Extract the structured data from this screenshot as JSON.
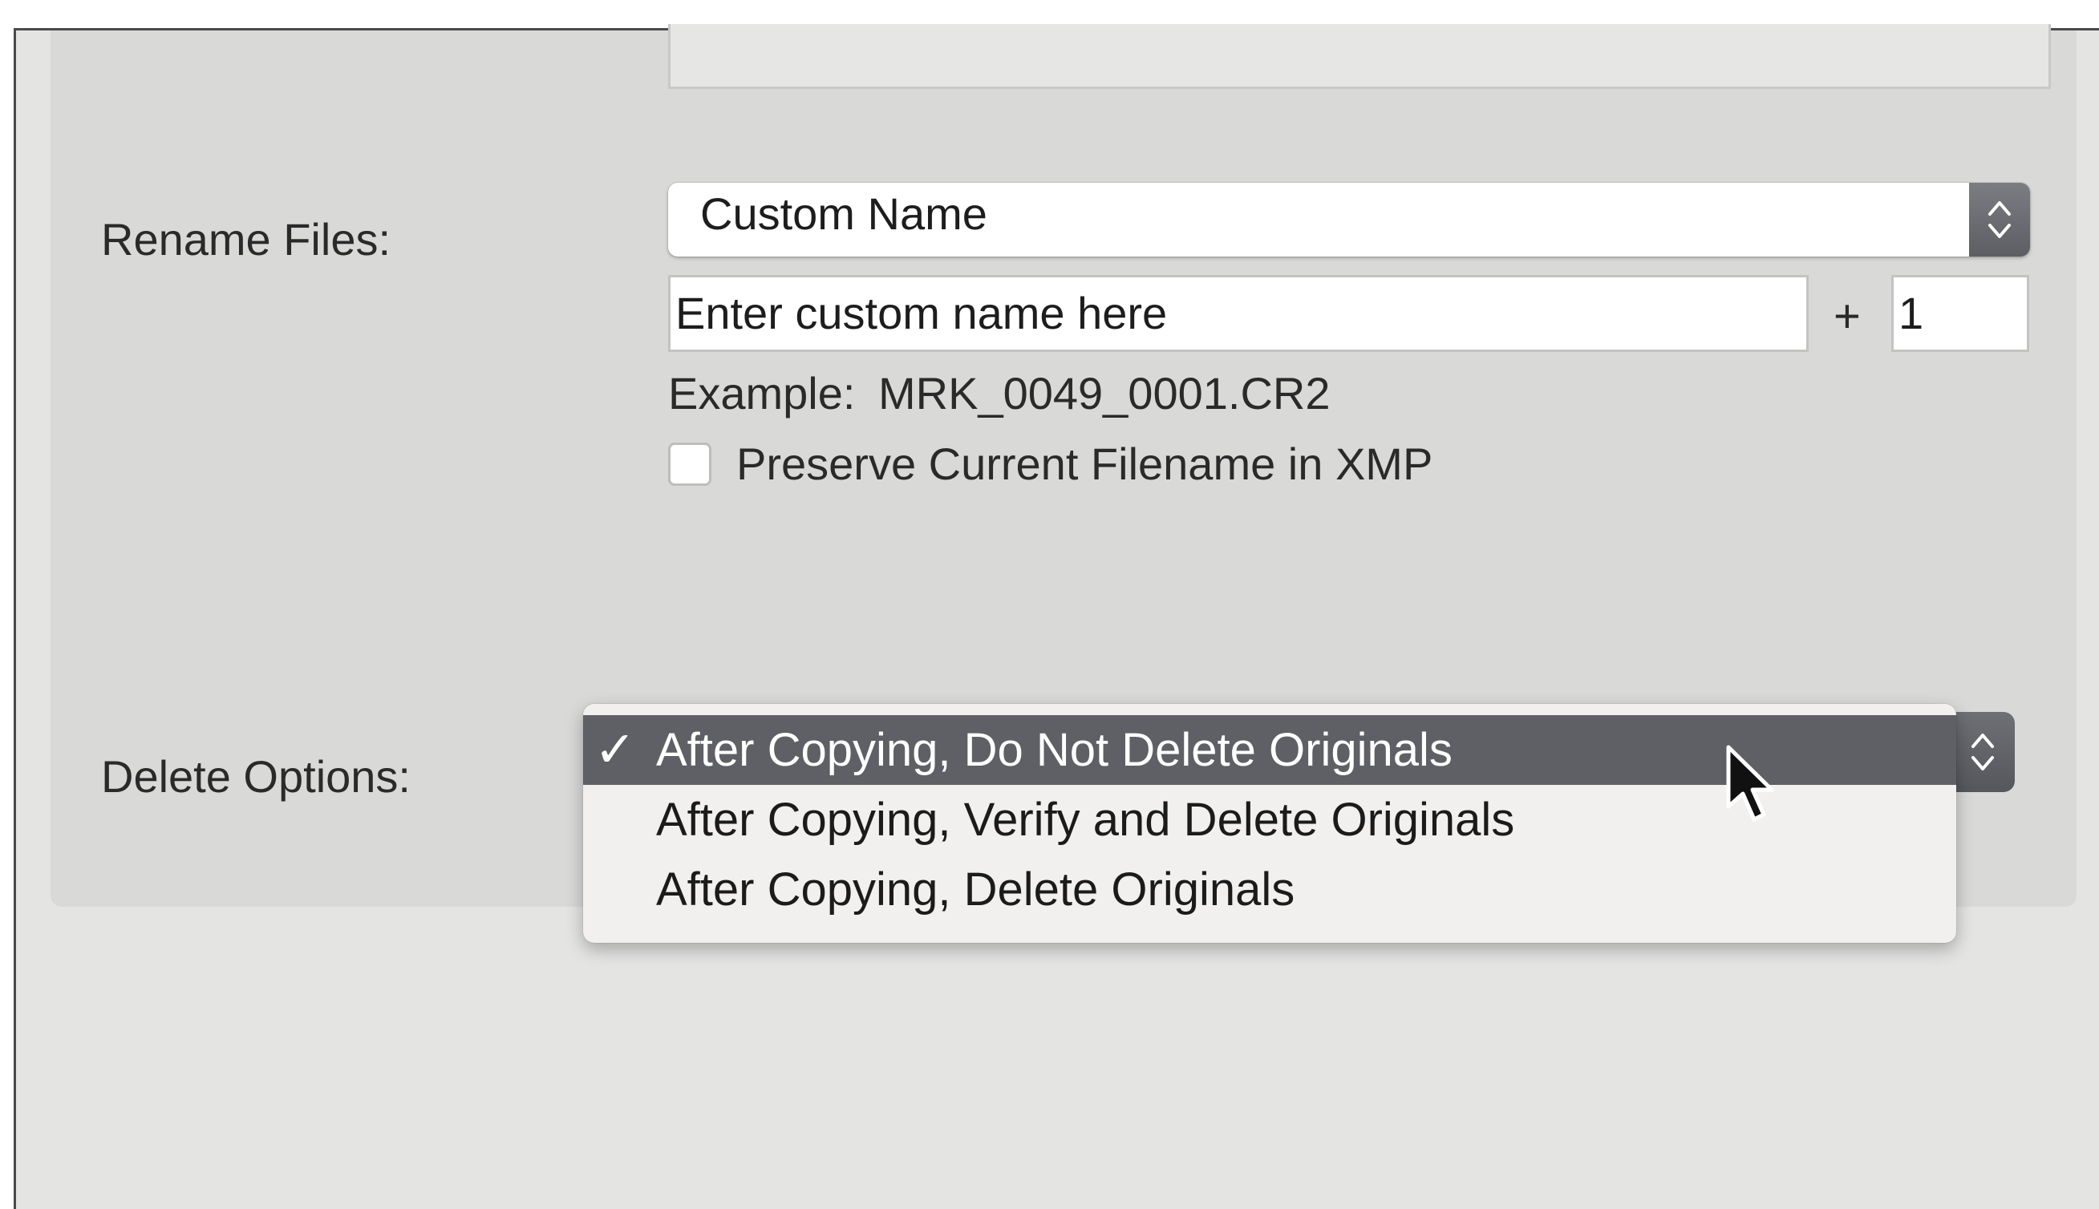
{
  "rename": {
    "label": "Rename Files:",
    "selected": "Custom Name",
    "custom_name_placeholder": "Enter custom name here",
    "plus_sign": "+",
    "start_number": "1",
    "example_label": "Example:",
    "example_value": "MRK_0049_0001.CR2",
    "preserve_label": "Preserve Current Filename in XMP",
    "preserve_checked": false
  },
  "delete_options": {
    "label": "Delete Options:",
    "selected_index": 0,
    "check_glyph": "✓",
    "items": [
      "After Copying, Do Not Delete Originals",
      "After Copying, Verify and Delete Originals",
      "After Copying, Delete Originals"
    ]
  },
  "colors": {
    "menu_highlight": "#5f6065",
    "panel_background": "#d9d9d8",
    "stepper": "#64666b"
  },
  "icons": {
    "stepper": "chevron-up-down-icon",
    "cursor": "mouse-pointer-icon"
  }
}
